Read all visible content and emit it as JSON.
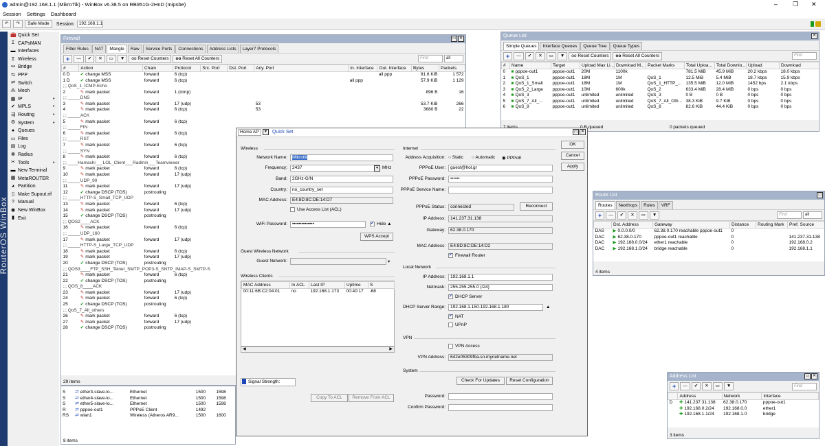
{
  "window": {
    "title": "admin@192.168.1.1 (MikroTik) - WinBox v6.38.5 on RB951G-2HnD (mipsbe)",
    "min": "–",
    "max": "❐",
    "close": "✕"
  },
  "menu": [
    "Session",
    "Settings",
    "Dashboard"
  ],
  "topbar": {
    "safe_mode": "Safe Mode",
    "session_label": "Session:",
    "session_value": "192.168.1.1"
  },
  "brand": "RouterOS WinBox",
  "sidebar": [
    {
      "label": "Quick Set",
      "icon": "quickset-icon",
      "glyph": "🧰",
      "sub": false
    },
    {
      "label": "CAPsMAN",
      "icon": "capsman-icon",
      "glyph": "Ɪ",
      "sub": false
    },
    {
      "label": "Interfaces",
      "icon": "interfaces-icon",
      "glyph": "▬",
      "sub": false
    },
    {
      "label": "Wireless",
      "icon": "wireless-icon",
      "glyph": "Ɪ",
      "sub": false
    },
    {
      "label": "Bridge",
      "icon": "bridge-icon",
      "glyph": "⚯",
      "sub": false
    },
    {
      "label": "PPP",
      "icon": "ppp-icon",
      "glyph": "⇆",
      "sub": false
    },
    {
      "label": "Switch",
      "icon": "switch-icon",
      "glyph": "⇄",
      "sub": false
    },
    {
      "label": "Mesh",
      "icon": "mesh-icon",
      "glyph": "⁂",
      "sub": false
    },
    {
      "label": "IP",
      "icon": "ip-icon",
      "glyph": "▦",
      "sub": true
    },
    {
      "label": "MPLS",
      "icon": "mpls-icon",
      "glyph": "✔",
      "sub": true
    },
    {
      "label": "Routing",
      "icon": "routing-icon",
      "glyph": "⇶",
      "sub": true
    },
    {
      "label": "System",
      "icon": "system-icon",
      "glyph": "⚙",
      "sub": true
    },
    {
      "label": "Queues",
      "icon": "queues-icon",
      "glyph": "●",
      "sub": false
    },
    {
      "label": "Files",
      "icon": "files-icon",
      "glyph": "▭",
      "sub": false
    },
    {
      "label": "Log",
      "icon": "log-icon",
      "glyph": "▤",
      "sub": false
    },
    {
      "label": "Radius",
      "icon": "radius-icon",
      "glyph": "☸",
      "sub": false
    },
    {
      "label": "Tools",
      "icon": "tools-icon",
      "glyph": "✂",
      "sub": true
    },
    {
      "label": "New Terminal",
      "icon": "terminal-icon",
      "glyph": "▬",
      "sub": false
    },
    {
      "label": "MetaROUTER",
      "icon": "metarouter-icon",
      "glyph": "▦",
      "sub": false
    },
    {
      "label": "Partition",
      "icon": "partition-icon",
      "glyph": "◕",
      "sub": false
    },
    {
      "label": "Make Supout.rif",
      "icon": "supout-icon",
      "glyph": "▯",
      "sub": false
    },
    {
      "label": "Manual",
      "icon": "manual-icon",
      "glyph": "?",
      "sub": false
    },
    {
      "label": "New WinBox",
      "icon": "winbox-icon",
      "glyph": "◉",
      "sub": false
    },
    {
      "label": "Exit",
      "icon": "exit-icon",
      "glyph": "▮",
      "sub": false
    }
  ],
  "firewall": {
    "title": "Firewall",
    "tabs": [
      "Filter Rules",
      "NAT",
      "Mangle",
      "Raw",
      "Service Ports",
      "Connections",
      "Address Lists",
      "Layer7 Protocols"
    ],
    "reset_counters": "Reset Counters",
    "reset_all": "Reset All Counters",
    "find": "Find",
    "filter": "all",
    "columns": [
      "#",
      "Action",
      "Chain",
      "Protocol",
      "Src. Port",
      "Dst. Port",
      "Any. Port",
      "In. Interface",
      "Out. Interface",
      "Bytes",
      "Packets"
    ],
    "rows": [
      {
        "c": [
          "0  D",
          "change MSS",
          "forward",
          "6 (tcp)",
          "",
          "",
          "",
          "",
          "all ppp",
          "81.6 KiB",
          "1 572"
        ]
      },
      {
        "c": [
          "1  D",
          "change MSS",
          "forward",
          "6 (tcp)",
          "",
          "",
          "",
          "all ppp",
          "",
          "57.9 KiB",
          "1 129"
        ]
      },
      {
        "comment": ";;; QoS_1_ICMP-Echo"
      },
      {
        "c": [
          "2",
          "mark packet",
          "forward",
          "1 (icmp)",
          "",
          "",
          "",
          "",
          "",
          "896 B",
          "16"
        ]
      },
      {
        "comment": ";;; _____DNS"
      },
      {
        "c": [
          "3",
          "mark packet",
          "forward",
          "17 (udp)",
          "",
          "",
          "53",
          "",
          "",
          "53.7 KiB",
          "266"
        ]
      },
      {
        "c": [
          "4",
          "mark packet",
          "forward",
          "6 (tcp)",
          "",
          "",
          "53",
          "",
          "",
          "3680 B",
          "22"
        ]
      },
      {
        "comment": ";;; _____ACK"
      },
      {
        "c": [
          "5",
          "mark packet",
          "forward",
          "6 (tcp)",
          "",
          "",
          "",
          "",
          "",
          "",
          ""
        ]
      },
      {
        "comment": ";;; _____FIN"
      },
      {
        "c": [
          "6",
          "mark packet",
          "forward",
          "6 (tcp)",
          "",
          "",
          "",
          "",
          "",
          "",
          ""
        ]
      },
      {
        "comment": ";;; _____RST"
      },
      {
        "c": [
          "7",
          "mark packet",
          "forward",
          "6 (tcp)",
          "",
          "",
          "",
          "",
          "",
          "",
          ""
        ]
      },
      {
        "comment": ";;; _____SYN"
      },
      {
        "c": [
          "8",
          "mark packet",
          "forward",
          "6 (tcp)",
          "",
          "",
          "",
          "",
          "",
          "",
          ""
        ]
      },
      {
        "comment": ";;; ____Hamachi___LOL_Client___Radmin___Teamviewer"
      },
      {
        "c": [
          "9",
          "mark packet",
          "forward",
          "6 (tcp)",
          "",
          "",
          "",
          "",
          "",
          "",
          ""
        ]
      },
      {
        "c": [
          "10",
          "mark packet",
          "forward",
          "17 (udp)",
          "",
          "",
          "",
          "",
          "",
          "",
          ""
        ]
      },
      {
        "comment": ";;; _____UDP_90"
      },
      {
        "c": [
          "11",
          "mark packet",
          "forward",
          "17 (udp)",
          "",
          "",
          "",
          "",
          "",
          "",
          ""
        ]
      },
      {
        "c": [
          "12",
          "change DSCP (TOS)",
          "postrouting",
          "",
          "",
          "",
          "",
          "",
          "",
          "",
          ""
        ]
      },
      {
        "comment": ";;; _____HTTP-S_Small_TCP_UDP"
      },
      {
        "c": [
          "13",
          "mark packet",
          "forward",
          "6 (tcp)",
          "",
          "",
          "",
          "",
          "",
          "",
          ""
        ]
      },
      {
        "c": [
          "14",
          "mark packet",
          "forward",
          "17 (udp)",
          "",
          "",
          "",
          "",
          "",
          "",
          ""
        ]
      },
      {
        "c": [
          "15",
          "change DSCP (TOS)",
          "postrouting",
          "",
          "",
          "",
          "",
          "",
          "",
          "",
          ""
        ]
      },
      {
        "comment": ";;; QOS2____ACK"
      },
      {
        "c": [
          "16",
          "mark packet",
          "forward",
          "6 (tcp)",
          "",
          "",
          "",
          "",
          "",
          "",
          ""
        ]
      },
      {
        "comment": ";;; _____UDP_160"
      },
      {
        "c": [
          "17",
          "mark packet",
          "forward",
          "17 (udp)",
          "",
          "",
          "",
          "",
          "",
          "",
          ""
        ]
      },
      {
        "comment": ";;; _____HTTP-S_Large_TCP_UDP"
      },
      {
        "c": [
          "18",
          "mark packet",
          "forward",
          "6 (tcp)",
          "",
          "",
          "",
          "",
          "",
          "",
          ""
        ]
      },
      {
        "c": [
          "19",
          "mark packet",
          "forward",
          "17 (udp)",
          "",
          "",
          "",
          "",
          "",
          "",
          ""
        ]
      },
      {
        "c": [
          "20",
          "change DSCP (TOS)",
          "postrouting",
          "",
          "",
          "",
          "",
          "",
          "",
          "",
          ""
        ]
      },
      {
        "comment": ";;; QOS3____FTP_SSH_Telnet_SMTP_POP3-S_SNTP_IMAP-S_SMTP-S"
      },
      {
        "c": [
          "21",
          "mark packet",
          "forward",
          "6 (tcp)",
          "",
          "",
          "",
          "",
          "",
          "",
          ""
        ]
      },
      {
        "c": [
          "22",
          "change DSCP (TOS)",
          "postrouting",
          "",
          "",
          "",
          "",
          "",
          "",
          "",
          ""
        ]
      },
      {
        "comment": ";;; QOS_8____ACK"
      },
      {
        "c": [
          "23",
          "mark packet",
          "forward",
          "17 (udp)",
          "",
          "",
          "",
          "",
          "",
          "",
          ""
        ]
      },
      {
        "c": [
          "24",
          "mark packet",
          "forward",
          "6 (tcp)",
          "",
          "",
          "",
          "",
          "",
          "",
          ""
        ]
      },
      {
        "c": [
          "25",
          "change DSCP (TOS)",
          "postrouting",
          "",
          "",
          "",
          "",
          "",
          "",
          "",
          ""
        ]
      },
      {
        "comment": ";;; QoS_7_All_others"
      },
      {
        "c": [
          "26",
          "mark packet",
          "forward",
          "6 (tcp)",
          "",
          "",
          "",
          "",
          "",
          "",
          ""
        ]
      },
      {
        "c": [
          "27",
          "mark packet",
          "forward",
          "17 (udp)",
          "",
          "",
          "",
          "",
          "",
          "",
          ""
        ]
      },
      {
        "c": [
          "28",
          "change DSCP (TOS)",
          "postrouting",
          "",
          "",
          "",
          "",
          "",
          "",
          "",
          ""
        ]
      }
    ],
    "items": "29 items"
  },
  "interfaces": {
    "rows": [
      {
        "c": [
          "S",
          "ether3-slave-lo...",
          "Ethernet",
          "1500",
          "1598"
        ]
      },
      {
        "c": [
          "S",
          "ether4-slave-lo...",
          "Ethernet",
          "1500",
          "1598"
        ]
      },
      {
        "c": [
          "S",
          "ether5-slave-lo...",
          "Ethernet",
          "1500",
          "1598"
        ]
      },
      {
        "c": [
          "R",
          "pppoe-out1",
          "PPPoE Client",
          "1492",
          ""
        ]
      },
      {
        "c": [
          "RS",
          "wlan1",
          "Wireless (Atheros AR9...",
          "1500",
          "1600"
        ]
      }
    ],
    "items": "8 items"
  },
  "queue": {
    "title": "Queue List",
    "tabs": [
      "Simple Queues",
      "Interface Queues",
      "Queue Tree",
      "Queue Types"
    ],
    "reset_counters": "Reset Counters",
    "reset_all": "Reset All Counters",
    "find": "Find",
    "columns": [
      "#",
      "Name",
      "Target",
      "Upload Max Li...",
      "Download M...",
      "Packet Marks",
      "Total Uploa...",
      "Total Downlo...",
      "Upload",
      "Download"
    ],
    "rows": [
      [
        "0",
        "pppoe-out1",
        "pppoe-out1",
        "20M",
        "1100k",
        "",
        "781.5 MiB",
        "45.9 MiB",
        "20.2 kbps",
        "18.0 kbps"
      ],
      [
        "1",
        "QoS_1",
        "pppoe-out1",
        "18M",
        "1M",
        "QoS_1",
        "12.5 MiB",
        "5.4 MiB",
        "18.7 kbps",
        "15.9 kbps"
      ],
      [
        "2",
        "QoS_1_Small",
        "pppoe-out1",
        "18M",
        "1M",
        "QoS_1_HTTP_...",
        "135.5 MiB",
        "12.0 MiB",
        "1452 bps",
        "2.1 kbps"
      ],
      [
        "3",
        "QoS_2_Large",
        "pppoe-out1",
        "10M",
        "600k",
        "QoS_2",
        "633.4 MiB",
        "28.4 MiB",
        "0 bps",
        "0 bps"
      ],
      [
        "4",
        "QoS_3",
        "pppoe-out1",
        "unlimited",
        "unlimited",
        "QoS_3",
        "0 B",
        "0 B",
        "0 bps",
        "0 bps"
      ],
      [
        "5",
        "QoS_7_All_...",
        "pppoe-out1",
        "unlimited",
        "unlimited",
        "QoS_7_All_Oth...",
        "38.3 KiB",
        "9.7 KiB",
        "0 bps",
        "0 bps"
      ],
      [
        "6",
        "QoS_8",
        "pppoe-out1",
        "unlimited",
        "unlimited",
        "QoS_8",
        "82.6 KiB",
        "44.4 KiB",
        "0 bps",
        "0 bps"
      ]
    ],
    "items": "7 items",
    "queued": "0 B queued",
    "packets_queued": "0 packets queued"
  },
  "quickset": {
    "title": "Quick Set",
    "mode": "Home AP",
    "wireless": {
      "section": "Wireless",
      "network_name_label": "Network Name:",
      "network_name": "Mikrotik",
      "frequency_label": "Frequency:",
      "frequency": "2437",
      "mhz": "MHz",
      "band_label": "Band:",
      "band": "2GHz-G/N",
      "country_label": "Country:",
      "country": "no_country_set",
      "mac_label": "MAC Address:",
      "mac": "E4:8D:8C:DE:14:D7",
      "acl_label": "Use Access List (ACL)",
      "wifi_pw_label": "WiFi Password:",
      "wifi_pw": "••••••••••••••",
      "hide": "Hide",
      "wps": "WPS Accept"
    },
    "guest": {
      "section": "Guest Wireless Network",
      "label": "Guest Network:",
      "value": ""
    },
    "clients": {
      "section": "Wireless Clients",
      "columns": [
        "MAC Address",
        "In ACL",
        "Last IP",
        "Uptime",
        "S"
      ],
      "rows": [
        [
          "00:11:6B:C2:04:01",
          "no",
          "192.168.1.173",
          "00:40:17",
          "-68"
        ]
      ],
      "signal": "Signal Strength:",
      "copy_acl": "Copy To ACL",
      "remove_acl": "Remove From ACL"
    },
    "internet": {
      "section": "Internet",
      "acq_label": "Address Acquisition:",
      "opt_static": "Static",
      "opt_auto": "Automatic",
      "opt_pppoe": "PPPoE",
      "user_label": "PPPoE User:",
      "user": "guest@hol.gr",
      "pw_label": "PPPoE Password:",
      "pw": "••••••",
      "svc_label": "PPPoE Service Name:",
      "svc": "",
      "status_label": "PPPoE Status:",
      "status": "connected",
      "reconnect": "Reconnect",
      "ip_label": "IP Address:",
      "ip": "141.237.31.138",
      "gw_label": "Gateway:",
      "gw": "62.38.0.170",
      "mac_label": "MAC Address:",
      "mac": "E4:8D:8C:DE:14:D2",
      "fw": "Firewall Router"
    },
    "local": {
      "section": "Local Network",
      "ip_label": "IP Address:",
      "ip": "192.168.1.1",
      "mask_label": "Netmask:",
      "mask": "255.255.255.0 (/24)",
      "dhcp": "DHCP Server",
      "range_label": "DHCP Server Range:",
      "range": "192.168.1.150-192.168.1.180",
      "nat": "NAT",
      "upnp": "UPnP"
    },
    "vpn": {
      "section": "VPN",
      "access": "VPN Access",
      "addr_label": "VPN Address:",
      "addr": "642e05309fba.sn.mynetname.net"
    },
    "system": {
      "section": "System",
      "check": "Check For Updates",
      "reset": "Reset Configuration",
      "pw_label": "Password:",
      "confirm_label": "Confirm Password:"
    },
    "ok": "OK",
    "cancel": "Cancel",
    "apply": "Apply"
  },
  "routes": {
    "title": "Route List",
    "tabs": [
      "Routes",
      "Nexthops",
      "Rules",
      "VRF"
    ],
    "find": "Find",
    "filter": "all",
    "columns": [
      "",
      "Dst. Address",
      "Gateway",
      "Distance",
      "Routing Mark",
      "Pref. Source"
    ],
    "rows": [
      [
        "DAS",
        "0.0.0.0/0",
        "62.38.0.170 reachable pppoe-out1",
        "0",
        "",
        ""
      ],
      [
        "DAC",
        "62.38.0.170",
        "pppoe-out1 reachable",
        "0",
        "",
        "141.237.31.138"
      ],
      [
        "DAC",
        "192.168.0.0/24",
        "ether1 reachable",
        "0",
        "",
        "192.168.0.2"
      ],
      [
        "DAC",
        "192.168.1.0/24",
        "bridge reachable",
        "0",
        "",
        "192.168.1.1"
      ]
    ],
    "items": "4 items"
  },
  "addresses": {
    "title": "Address List",
    "find": "Find",
    "columns": [
      "",
      "Address",
      "Network",
      "Interface"
    ],
    "rows": [
      [
        "D",
        "141.237.31.138",
        "62.38.0.170",
        "pppoe-out1"
      ],
      [
        "",
        "192.168.0.2/24",
        "192.168.0.0",
        "ether1"
      ],
      [
        "",
        "192.168.1.1/24",
        "192.168.1.0",
        "bridge"
      ]
    ],
    "items": "3 items"
  }
}
